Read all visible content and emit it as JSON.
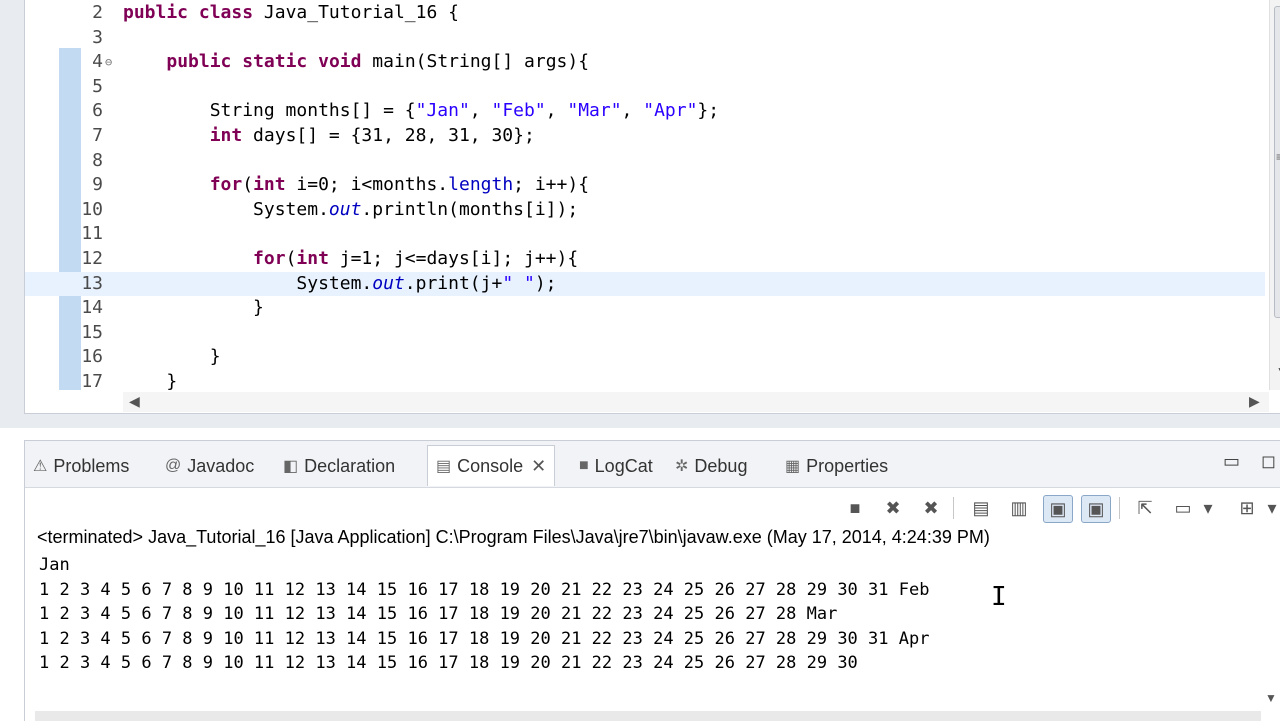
{
  "editor": {
    "lines": [
      {
        "num": "2",
        "html_parts": [
          [
            "kw",
            "public"
          ],
          [
            "t",
            " "
          ],
          [
            "kw",
            "class"
          ],
          [
            "t",
            " Java_Tutorial_16 {"
          ]
        ]
      },
      {
        "num": "3",
        "html_parts": []
      },
      {
        "num": "4",
        "fold": "⊖",
        "html_parts": [
          [
            "t",
            "    "
          ],
          [
            "kw",
            "public"
          ],
          [
            "t",
            " "
          ],
          [
            "kw",
            "static"
          ],
          [
            "t",
            " "
          ],
          [
            "kw",
            "void"
          ],
          [
            "t",
            " main(String[] args){"
          ]
        ]
      },
      {
        "num": "5",
        "html_parts": []
      },
      {
        "num": "6",
        "html_parts": [
          [
            "t",
            "        String months[] = {"
          ],
          [
            "str",
            "\"Jan\""
          ],
          [
            "t",
            ", "
          ],
          [
            "str",
            "\"Feb\""
          ],
          [
            "t",
            ", "
          ],
          [
            "str",
            "\"Mar\""
          ],
          [
            "t",
            ", "
          ],
          [
            "str",
            "\"Apr\""
          ],
          [
            "t",
            "};"
          ]
        ]
      },
      {
        "num": "7",
        "html_parts": [
          [
            "t",
            "        "
          ],
          [
            "kw",
            "int"
          ],
          [
            "t",
            " days[] = {31, 28, 31, 30};"
          ]
        ]
      },
      {
        "num": "8",
        "html_parts": []
      },
      {
        "num": "9",
        "html_parts": [
          [
            "t",
            "        "
          ],
          [
            "kw",
            "for"
          ],
          [
            "t",
            "("
          ],
          [
            "kw",
            "int"
          ],
          [
            "t",
            " i=0; i<months."
          ],
          [
            "fldn",
            "length"
          ],
          [
            "t",
            "; i++){"
          ]
        ]
      },
      {
        "num": "10",
        "html_parts": [
          [
            "t",
            "            System."
          ],
          [
            "fld",
            "out"
          ],
          [
            "t",
            ".println(months[i]);"
          ]
        ]
      },
      {
        "num": "11",
        "html_parts": []
      },
      {
        "num": "12",
        "html_parts": [
          [
            "t",
            "            "
          ],
          [
            "kw",
            "for"
          ],
          [
            "t",
            "("
          ],
          [
            "kw",
            "int"
          ],
          [
            "t",
            " j=1; j<=days[i]; j++){"
          ]
        ]
      },
      {
        "num": "13",
        "current": true,
        "html_parts": [
          [
            "t",
            "                System."
          ],
          [
            "fld",
            "out"
          ],
          [
            "t",
            ".print(j+"
          ],
          [
            "str",
            "\" \""
          ],
          [
            "t",
            ");"
          ]
        ]
      },
      {
        "num": "14",
        "html_parts": [
          [
            "t",
            "            }"
          ]
        ]
      },
      {
        "num": "15",
        "html_parts": []
      },
      {
        "num": "16",
        "html_parts": [
          [
            "t",
            "        }"
          ]
        ]
      },
      {
        "num": "17",
        "html_parts": [
          [
            "t",
            "    }"
          ]
        ]
      }
    ]
  },
  "console_panel": {
    "tabs": [
      {
        "label": "Problems",
        "icon": "problems-icon",
        "glyph": "⚠"
      },
      {
        "label": "Javadoc",
        "icon": "javadoc-icon",
        "glyph": "@"
      },
      {
        "label": "Declaration",
        "icon": "declaration-icon",
        "glyph": "◧"
      },
      {
        "label": "Console",
        "icon": "console-icon",
        "glyph": "▤",
        "active": true
      },
      {
        "label": "LogCat",
        "icon": "logcat-icon",
        "glyph": "■"
      },
      {
        "label": "Debug",
        "icon": "debug-icon",
        "glyph": "✲"
      },
      {
        "label": "Properties",
        "icon": "properties-icon",
        "glyph": "▦"
      }
    ],
    "close_glyph": "✕",
    "terminated_text": "<terminated> Java_Tutorial_16 [Java Application] C:\\Program Files\\Java\\jre7\\bin\\javaw.exe (May 17, 2014, 4:24:39 PM)",
    "output": "Jan\n1 2 3 4 5 6 7 8 9 10 11 12 13 14 15 16 17 18 19 20 21 22 23 24 25 26 27 28 29 30 31 Feb\n1 2 3 4 5 6 7 8 9 10 11 12 13 14 15 16 17 18 19 20 21 22 23 24 25 26 27 28 Mar\n1 2 3 4 5 6 7 8 9 10 11 12 13 14 15 16 17 18 19 20 21 22 23 24 25 26 27 28 29 30 31 Apr\n1 2 3 4 5 6 7 8 9 10 11 12 13 14 15 16 17 18 19 20 21 22 23 24 25 26 27 28 29 30"
  },
  "toolbar_icons": [
    {
      "name": "terminate-icon",
      "glyph": "■"
    },
    {
      "name": "remove-launch-icon",
      "glyph": "✖"
    },
    {
      "name": "remove-all-icon",
      "glyph": "✖"
    },
    {
      "name": "scroll-lock-icon",
      "glyph": "▤"
    },
    {
      "name": "clear-console-icon",
      "glyph": "▥"
    },
    {
      "name": "show-on-stdout-icon",
      "glyph": "▣",
      "pressed": true
    },
    {
      "name": "show-on-stderr-icon",
      "glyph": "▣",
      "pressed": true
    },
    {
      "name": "pin-console-icon",
      "glyph": "⇱"
    },
    {
      "name": "display-console-icon",
      "glyph": "▭"
    },
    {
      "name": "dropdown-icon",
      "glyph": "▾"
    },
    {
      "name": "open-console-icon",
      "glyph": "⊞"
    },
    {
      "name": "dropdown-icon",
      "glyph": "▾"
    }
  ],
  "colors": {
    "keyword": "#7f0055",
    "string": "#2a00ff",
    "field": "#0000c0",
    "current_line": "#e8f2fe"
  }
}
